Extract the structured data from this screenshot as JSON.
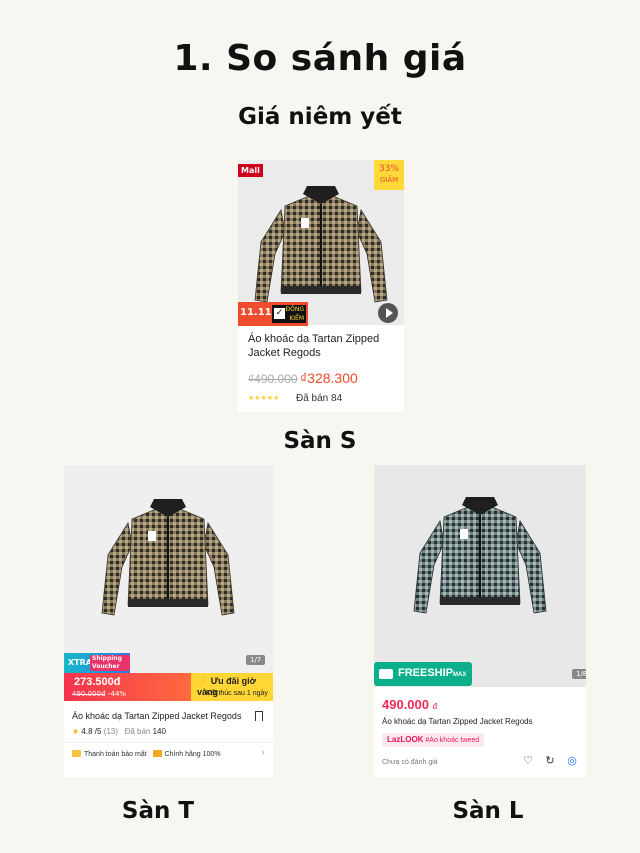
{
  "header": {
    "title": "1. So sánh giá",
    "subtitle": "Giá niêm yết"
  },
  "store_s": {
    "caption": "Sàn S",
    "mall_badge": "Mall",
    "discount_pct": "33%",
    "discount_label": "GIẢM",
    "sale_badge": "11.11",
    "sale_check_label": "ĐỒNG KIỂM",
    "product_name": "Áo khoác dạ Tartan Zipped Jacket Regods",
    "old_price": "₫490.000",
    "new_price": "₫328.300",
    "rating_stars": 4.5,
    "sold": "Đã bán 84",
    "colors": {
      "accent": "#ee4d2d"
    }
  },
  "store_t": {
    "caption": "Sàn T",
    "xtra_label": "XTRA",
    "xtra_sub": "Shipping Voucher",
    "page_indicator": "1/7",
    "price": "273.500đ",
    "old_price": "490.000đ",
    "discount_pct": "-44%",
    "flash_label": "Ưu đãi giờ vàng",
    "flash_timer": "Kết thúc sau 1 ngày",
    "product_name": "Áo khoác dạ Tartan Zipped Jacket Regods",
    "rating": "4.8",
    "rating_scale": "/5",
    "rating_count": "(13)",
    "sold_label": "Đã bán",
    "sold_count": "140",
    "footer_secure": "Thanh toán bảo mật",
    "footer_authentic": "Chính hãng 100%",
    "colors": {
      "accent": "#f5334f",
      "flash": "#ffd633"
    }
  },
  "store_l": {
    "caption": "Sàn L",
    "freeship_label": "FREESHIP",
    "freeship_suffix": "MAX",
    "page_indicator": "1/8",
    "price": "490.000",
    "currency": "đ",
    "product_name": "Áo khoác dạ Tartan Zipped Jacket Regods",
    "tag_brand": "LazLOOK",
    "tag_text": "#Áo khoác tweed",
    "review_text": "Chưa có đánh giá",
    "icons": [
      "heart-icon",
      "share-icon",
      "chat-icon"
    ],
    "colors": {
      "accent": "#f02a57",
      "freeship": "#0bb08a"
    }
  }
}
